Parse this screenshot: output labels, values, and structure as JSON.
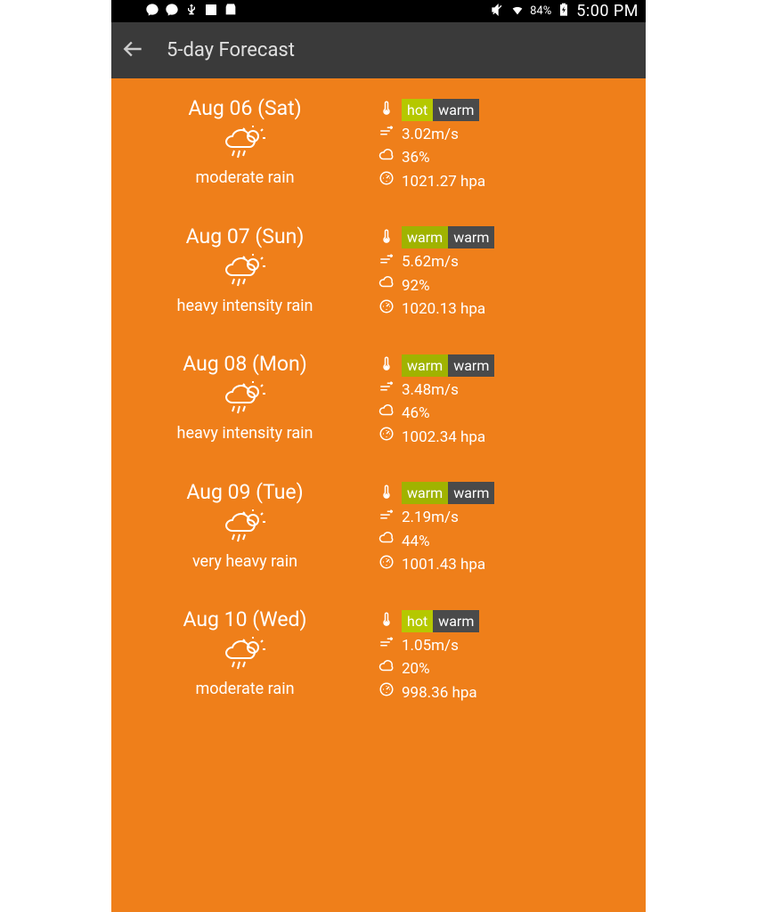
{
  "statusbar": {
    "battery": "84%",
    "clock": "5:00 PM"
  },
  "appbar": {
    "title": "5-day Forecast"
  },
  "days": [
    {
      "date": "Aug 06 (Sat)",
      "condition": "moderate rain",
      "hi_label": "hot",
      "hi_class": "hot",
      "lo_label": "warm",
      "wind": "3.02m/s",
      "cloud": "36%",
      "pressure": "1021.27 hpa"
    },
    {
      "date": "Aug 07 (Sun)",
      "condition": "heavy intensity rain",
      "hi_label": "warm",
      "hi_class": "warm-hi",
      "lo_label": "warm",
      "wind": "5.62m/s",
      "cloud": "92%",
      "pressure": "1020.13 hpa"
    },
    {
      "date": "Aug 08 (Mon)",
      "condition": "heavy intensity rain",
      "hi_label": "warm",
      "hi_class": "warm-hi",
      "lo_label": "warm",
      "wind": "3.48m/s",
      "cloud": "46%",
      "pressure": "1002.34 hpa"
    },
    {
      "date": "Aug 09 (Tue)",
      "condition": "very heavy rain",
      "hi_label": "warm",
      "hi_class": "warm-hi",
      "lo_label": "warm",
      "wind": "2.19m/s",
      "cloud": "44%",
      "pressure": "1001.43 hpa"
    },
    {
      "date": "Aug 10 (Wed)",
      "condition": "moderate rain",
      "hi_label": "hot",
      "hi_class": "hot",
      "lo_label": "warm",
      "wind": "1.05m/s",
      "cloud": "20%",
      "pressure": "998.36 hpa"
    }
  ]
}
